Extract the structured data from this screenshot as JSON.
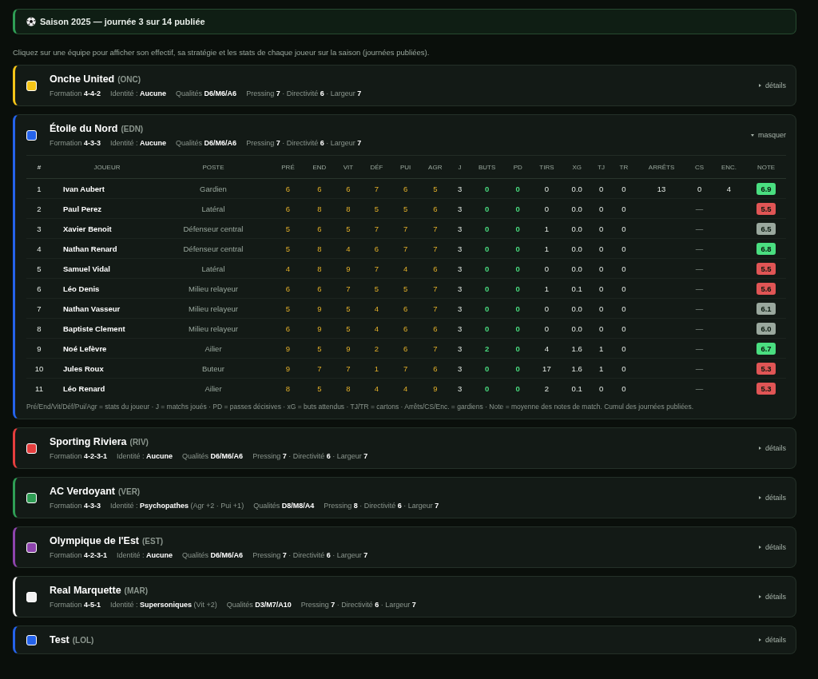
{
  "banner": {
    "title": "Saison 2025 — journée 3 sur 14 publiée"
  },
  "intro": "Cliquez sur une équipe pour afficher son effectif, sa stratégie et les stats de chaque joueur sur la saison (journées publiées).",
  "teams": [
    {
      "name": "Onche United",
      "code": "(ONC)",
      "color": "#f5c518",
      "expanded": false,
      "toggle": "détails",
      "meta": [
        "Formation **4-4-2**",
        "Identité : **Aucune**",
        "Qualités **D6/M6/A6**",
        "Pressing **7** · Directivité **6** · Largeur **7**"
      ]
    },
    {
      "name": "Étoile du Nord",
      "code": "(EDN)",
      "color": "#2563eb",
      "expanded": true,
      "toggle": "masquer",
      "meta": [
        "Formation **4-3-3**",
        "Identité : **Aucune**",
        "Qualités **D6/M6/A6**",
        "Pressing **7** · Directivité **6** · Largeur **7**"
      ],
      "table": {
        "columns": [
          {
            "label": "#",
            "kind": "num"
          },
          {
            "label": "JOUEUR",
            "kind": "name"
          },
          {
            "label": "POSTE",
            "kind": "pos"
          },
          {
            "label": "PRÉ",
            "kind": "attr"
          },
          {
            "label": "END",
            "kind": "attr"
          },
          {
            "label": "VIT",
            "kind": "attr"
          },
          {
            "label": "DÉF",
            "kind": "attr"
          },
          {
            "label": "PUI",
            "kind": "attr"
          },
          {
            "label": "AGR",
            "kind": "attr"
          },
          {
            "label": "J",
            "kind": "plain"
          },
          {
            "label": "BUTS",
            "kind": "goal"
          },
          {
            "label": "PD",
            "kind": "goal"
          },
          {
            "label": "TIRS",
            "kind": "plain"
          },
          {
            "label": "XG",
            "kind": "plain"
          },
          {
            "label": "TJ",
            "kind": "plain"
          },
          {
            "label": "TR",
            "kind": "plain"
          },
          {
            "label": "ARRÊTS",
            "kind": "gk"
          },
          {
            "label": "CS",
            "kind": "gk"
          },
          {
            "label": "ENC.",
            "kind": "gk"
          },
          {
            "label": "NOTE",
            "kind": "note"
          }
        ],
        "rows": [
          {
            "cells": [
              "1",
              "Ivan Aubert",
              "Gardien",
              "6",
              "6",
              "6",
              "7",
              "6",
              "5",
              "3",
              "0",
              "0",
              "0",
              "0.0",
              "0",
              "0",
              "13",
              "0",
              "4",
              "6.9"
            ],
            "color": "#4ade80"
          },
          {
            "cells": [
              "2",
              "Paul Perez",
              "Latéral",
              "6",
              "8",
              "8",
              "5",
              "5",
              "6",
              "3",
              "0",
              "0",
              "0",
              "0.0",
              "0",
              "0",
              "—",
              "5.5"
            ],
            "color": "#e05555"
          },
          {
            "cells": [
              "3",
              "Xavier Benoit",
              "Défenseur central",
              "5",
              "6",
              "5",
              "7",
              "7",
              "7",
              "3",
              "0",
              "0",
              "1",
              "0.0",
              "0",
              "0",
              "—",
              "6.5"
            ],
            "color": "#9aa89e"
          },
          {
            "cells": [
              "4",
              "Nathan Renard",
              "Défenseur central",
              "5",
              "8",
              "4",
              "6",
              "7",
              "7",
              "3",
              "0",
              "0",
              "1",
              "0.0",
              "0",
              "0",
              "—",
              "6.8"
            ],
            "color": "#4ade80"
          },
          {
            "cells": [
              "5",
              "Samuel Vidal",
              "Latéral",
              "4",
              "8",
              "9",
              "7",
              "4",
              "6",
              "3",
              "0",
              "0",
              "0",
              "0.0",
              "0",
              "0",
              "—",
              "5.5"
            ],
            "color": "#e05555"
          },
          {
            "cells": [
              "6",
              "Léo Denis",
              "Milieu relayeur",
              "6",
              "6",
              "7",
              "5",
              "5",
              "7",
              "3",
              "0",
              "0",
              "1",
              "0.1",
              "0",
              "0",
              "—",
              "5.6"
            ],
            "color": "#e05555"
          },
          {
            "cells": [
              "7",
              "Nathan Vasseur",
              "Milieu relayeur",
              "5",
              "9",
              "5",
              "4",
              "6",
              "7",
              "3",
              "0",
              "0",
              "0",
              "0.0",
              "0",
              "0",
              "—",
              "6.1"
            ],
            "color": "#9aa89e"
          },
          {
            "cells": [
              "8",
              "Baptiste Clement",
              "Milieu relayeur",
              "6",
              "9",
              "5",
              "4",
              "6",
              "6",
              "3",
              "0",
              "0",
              "0",
              "0.0",
              "0",
              "0",
              "—",
              "6.0"
            ],
            "color": "#9aa89e"
          },
          {
            "cells": [
              "9",
              "Noé Lefèvre",
              "Ailier",
              "9",
              "5",
              "9",
              "2",
              "6",
              "7",
              "3",
              "2",
              "0",
              "4",
              "1.6",
              "1",
              "0",
              "—",
              "6.7"
            ],
            "color": "#4ade80"
          },
          {
            "cells": [
              "10",
              "Jules Roux",
              "Buteur",
              "9",
              "7",
              "7",
              "1",
              "7",
              "6",
              "3",
              "0",
              "0",
              "17",
              "1.6",
              "1",
              "0",
              "—",
              "5.3"
            ],
            "color": "#e05555"
          },
          {
            "cells": [
              "11",
              "Léo Renard",
              "Ailier",
              "8",
              "5",
              "8",
              "4",
              "4",
              "9",
              "3",
              "0",
              "0",
              "2",
              "0.1",
              "0",
              "0",
              "—",
              "5.3"
            ],
            "color": "#e05555"
          }
        ]
      },
      "legend": "Pré/End/Vit/Déf/Pui/Agr = stats du joueur · J = matchs joués · PD = passes décisives · xG = buts attendus · TJ/TR = cartons · Arrêts/CS/Enc. = gardiens · Note = moyenne des notes de match. Cumul des journées publiées."
    },
    {
      "name": "Sporting Riviera",
      "code": "(RIV)",
      "color": "#e53e3e",
      "expanded": false,
      "toggle": "détails",
      "meta": [
        "Formation **4-2-3-1**",
        "Identité : **Aucune**",
        "Qualités **D6/M6/A6**",
        "Pressing **7** · Directivité **6** · Largeur **7**"
      ]
    },
    {
      "name": "AC Verdoyant",
      "code": "(VER)",
      "color": "#2f9e55",
      "expanded": false,
      "toggle": "détails",
      "meta": [
        "Formation **4-3-3**",
        "Identité : **Psychopathes** (Agr +2 · Pui +1)",
        "Qualités **D8/M8/A4**",
        "Pressing **8** · Directivité **6** · Largeur **7**"
      ]
    },
    {
      "name": "Olympique de l'Est",
      "code": "(EST)",
      "color": "#8e44ad",
      "expanded": false,
      "toggle": "détails",
      "meta": [
        "Formation **4-2-3-1**",
        "Identité : **Aucune**",
        "Qualités **D6/M6/A6**",
        "Pressing **7** · Directivité **6** · Largeur **7**"
      ]
    },
    {
      "name": "Real Marquette",
      "code": "(MAR)",
      "color": "#f2f2f2",
      "expanded": false,
      "toggle": "détails",
      "meta": [
        "Formation **4-5-1**",
        "Identité : **Supersoniques** (Vit +2)",
        "Qualités **D3/M7/A10**",
        "Pressing **7** · Directivité **6** · Largeur **7**"
      ]
    },
    {
      "name": "Test",
      "code": "(LOL)",
      "color": "#2563eb",
      "expanded": false,
      "toggle": "détails"
    }
  ]
}
